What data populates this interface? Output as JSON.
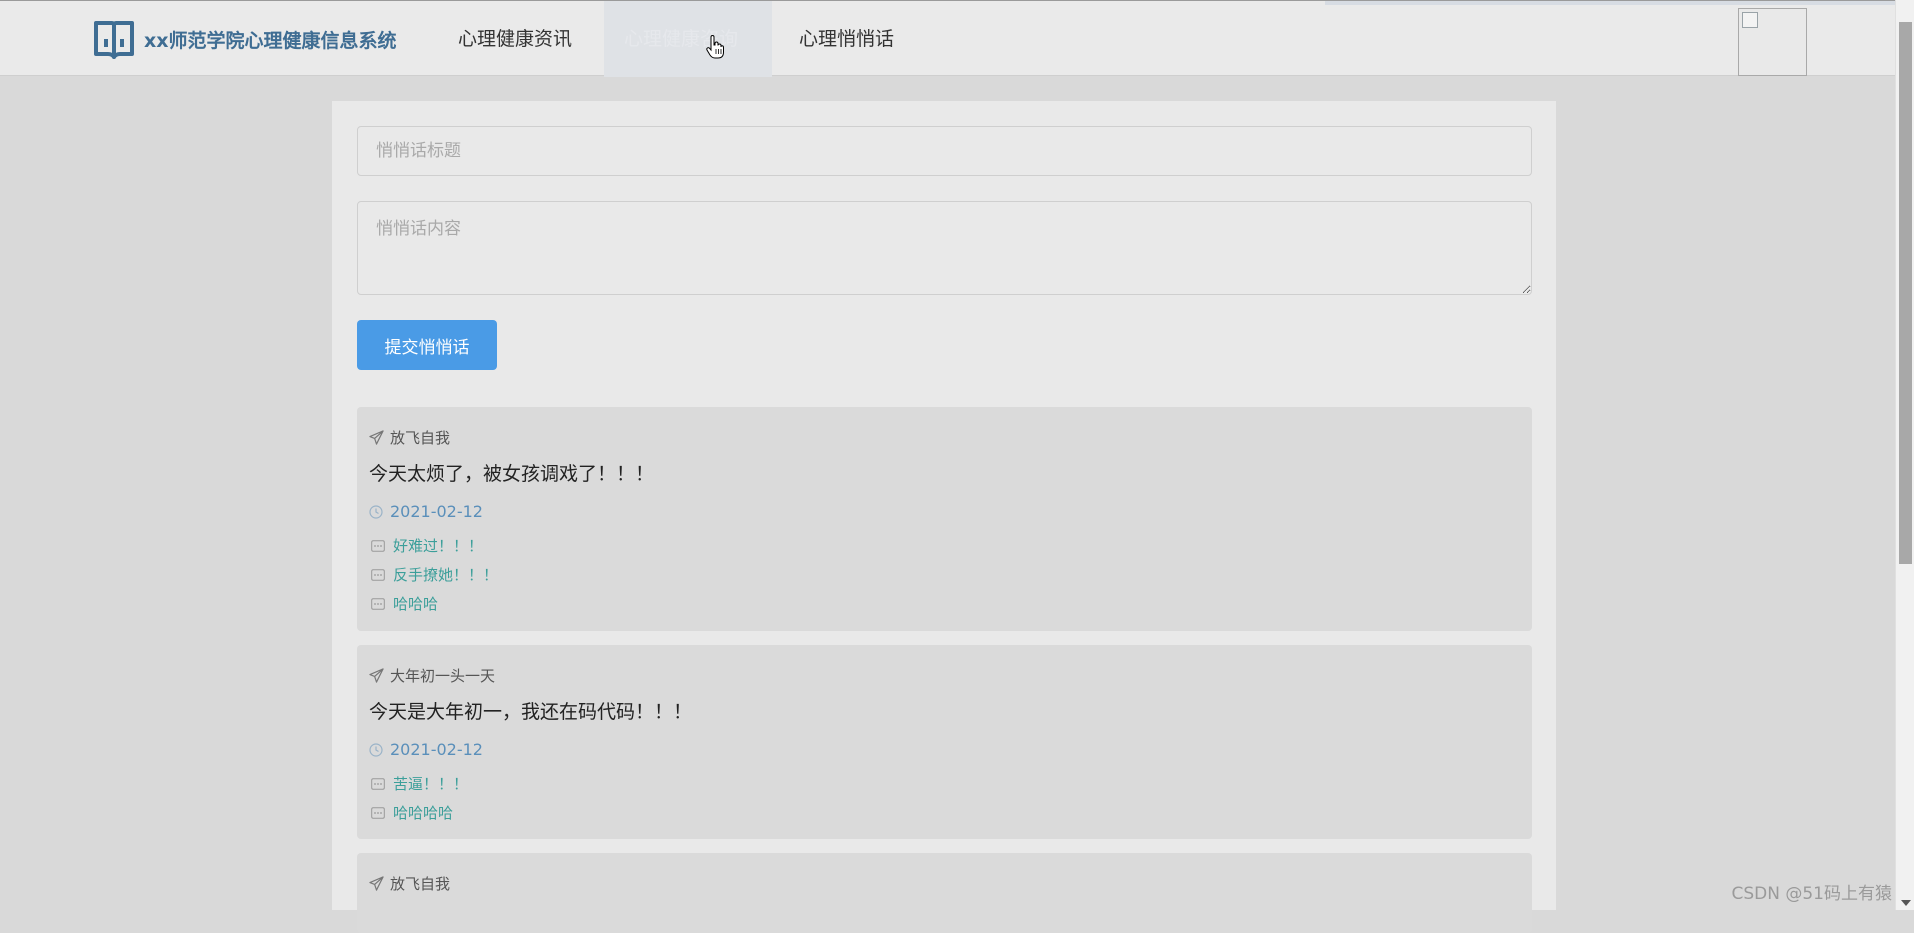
{
  "header": {
    "brand_title": "xx师范学院心理健康信息系统",
    "nav": {
      "news": "心理健康资讯",
      "consult": "心理健康咨询",
      "whisper": "心理悄悄话"
    }
  },
  "form": {
    "title_placeholder": "悄悄话标题",
    "content_placeholder": "悄悄话内容",
    "submit_label": "提交悄悄话"
  },
  "posts": [
    {
      "author": "放飞自我",
      "content": "今天太烦了，被女孩调戏了！！！",
      "date": "2021-02-12",
      "replies": [
        "好难过！！！",
        "反手撩她！！！",
        "哈哈哈"
      ]
    },
    {
      "author": "大年初一头一天",
      "content": "今天是大年初一，我还在码代码！！！",
      "date": "2021-02-12",
      "replies": [
        "苦逼！！！",
        "哈哈哈哈"
      ]
    },
    {
      "author": "放飞自我"
    }
  ],
  "watermark": "CSDN @51码上有猿",
  "colors": {
    "brand": "#3f6d93",
    "primary_button": "#4a9be6",
    "date": "#5a8fba",
    "reply": "#3c9f9a"
  },
  "icons": {
    "brand": "book-icon",
    "author": "paper-plane-icon",
    "date": "clock-icon",
    "reply": "comment-icon"
  }
}
